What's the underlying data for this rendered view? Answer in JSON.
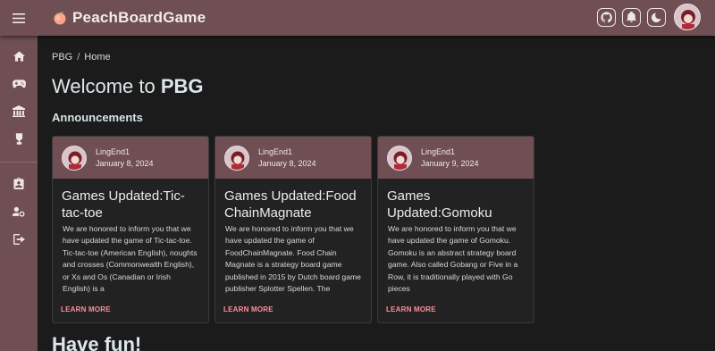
{
  "app": {
    "brand": "PeachBoardGame"
  },
  "breadcrumb": {
    "root": "PBG",
    "separator": "/",
    "current": "Home"
  },
  "main": {
    "title_prefix": "Welcome to ",
    "title_bold": "PBG",
    "announcements_heading": "Announcements",
    "footer_heading": "Have fun!"
  },
  "sidebar": {
    "items": [
      {
        "icon": "home-icon"
      },
      {
        "icon": "gamepad-icon"
      },
      {
        "icon": "museum-icon"
      },
      {
        "icon": "trophy-icon"
      },
      {
        "icon": "clipboard-account-icon"
      },
      {
        "icon": "account-cog-icon"
      },
      {
        "icon": "logout-icon"
      }
    ]
  },
  "top_actions": [
    "github-icon",
    "bell-icon",
    "dark-mode-icon",
    "user-avatar"
  ],
  "announcements": [
    {
      "author": "LingEnd1",
      "date": "January 8, 2024",
      "title": "Games Updated:Tic-tac-toe",
      "body": "We are honored to inform you that we have updated the game of Tic-tac-toe. Tic-tac-toe (American English), noughts and crosses (Commonwealth English), or Xs and Os (Canadian or Irish English) is a",
      "link": "LEARN MORE"
    },
    {
      "author": "LingEnd1",
      "date": "January 8, 2024",
      "title": "Games Updated:FoodChainMagnate",
      "body": "We are honored to inform you that we have updated the game of FoodChainMagnate. Food Chain Magnate is a strategy board game published in 2015 by Dutch board game publisher Splotter Spellen. The",
      "link": "LEARN MORE"
    },
    {
      "author": "LingEnd1",
      "date": "January 9, 2024",
      "title": "Games Updated:Gomoku",
      "body": "We are honored to inform you that we have updated the game of Gomoku. Gomoku is an abstract strategy board game. Also called Gobang or Five in a Row, it is traditionally played with Go pieces",
      "link": "LEARN MORE"
    }
  ],
  "colors": {
    "bar": "#6f4f53",
    "background": "#1b1b1b",
    "card": "#222222",
    "link": "#ff8f9a"
  }
}
